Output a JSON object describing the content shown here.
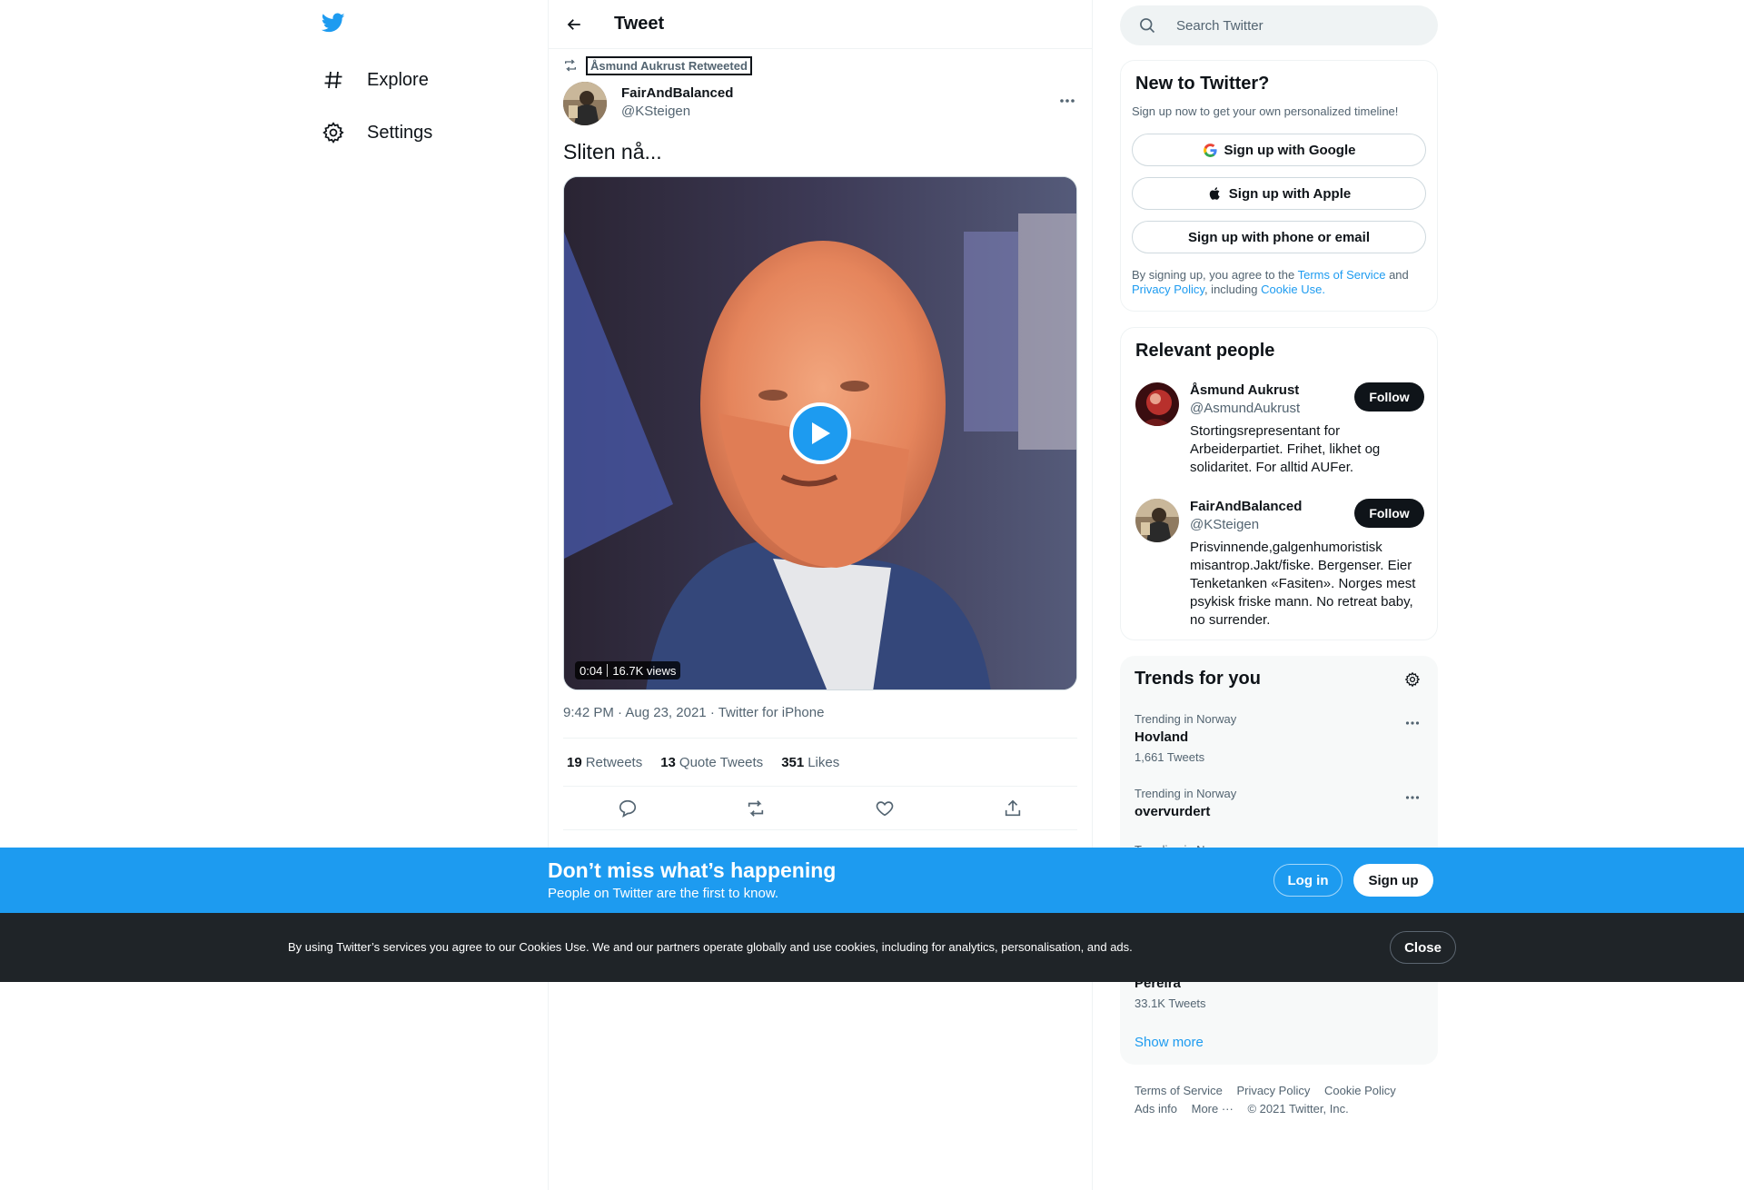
{
  "nav": {
    "logo_icon": "twitter-bird-icon",
    "items": [
      {
        "label": "Explore",
        "icon": "hashtag-icon"
      },
      {
        "label": "Settings",
        "icon": "gear-icon"
      }
    ]
  },
  "header": {
    "title": "Tweet",
    "back_icon": "back-arrow-icon"
  },
  "tweet": {
    "retweeted_by": "Åsmund Aukrust Retweeted",
    "author_name": "FairAndBalanced",
    "author_handle": "@KSteigen",
    "text": "Sliten nå...",
    "video": {
      "duration": "0:04",
      "views": "16.7K views"
    },
    "time": "9:42 PM",
    "date": "Aug 23, 2021",
    "source": "Twitter for iPhone",
    "stats": [
      {
        "count": "19",
        "label": "Retweets"
      },
      {
        "count": "13",
        "label": "Quote Tweets"
      },
      {
        "count": "351",
        "label": "Likes"
      }
    ]
  },
  "search": {
    "placeholder": "Search Twitter"
  },
  "new_to_twitter": {
    "title": "New to Twitter?",
    "subtitle": "Sign up now to get your own personalized timeline!",
    "google_label": "Sign up with Google",
    "apple_label": "Sign up with Apple",
    "phone_label": "Sign up with phone or email",
    "legal_prefix": "By signing up, you agree to the",
    "terms": "Terms of Service",
    "and": "and",
    "privacy": "Privacy Policy",
    "including": ", including",
    "cookie": "Cookie Use."
  },
  "relevant_people": {
    "title": "Relevant people",
    "follow_label": "Follow",
    "people": [
      {
        "name": "Åsmund Aukrust",
        "handle": "@AsmundAukrust",
        "bio": "Stortingsrepresentant for Arbeiderpartiet. Frihet, likhet og solidaritet. For alltid AUFer."
      },
      {
        "name": "FairAndBalanced",
        "handle": "@KSteigen",
        "bio": "Prisvinnende,galgenhumoristisk misantrop.Jakt/fiske. Bergenser. Eier Tenketanken «Fasiten». Norges mest psykisk friske mann. No retreat baby, no surrender."
      }
    ]
  },
  "trends": {
    "title": "Trends for you",
    "items": [
      {
        "context": "Trending in Norway",
        "name": "Hovland",
        "count": "1,661 Tweets"
      },
      {
        "context": "Trending in Norway",
        "name": "overvurdert",
        "count": ""
      },
      {
        "context": "Trending in Norway",
        "name": "Pereira",
        "count": "33.1K Tweets"
      }
    ],
    "show_more": "Show more"
  },
  "footer": {
    "links": [
      "Terms of Service",
      "Privacy Policy",
      "Cookie Policy",
      "Ads info",
      "More ···"
    ],
    "copyright": "© 2021 Twitter, Inc."
  },
  "signup_bar": {
    "title": "Don’t miss what’s happening",
    "subtitle": "People on Twitter are the first to know.",
    "login_label": "Log in",
    "signup_label": "Sign up"
  },
  "cookie_bar": {
    "text": "By using Twitter’s services you agree to our Cookies Use. We and our partners operate globally and use cookies, including for analytics, personalisation, and ads.",
    "close_label": "Close"
  },
  "colors": {
    "accent": "#1d9bf0",
    "text": "#0f1419",
    "secondary": "#536471",
    "cookie_bg": "#1f2428"
  }
}
